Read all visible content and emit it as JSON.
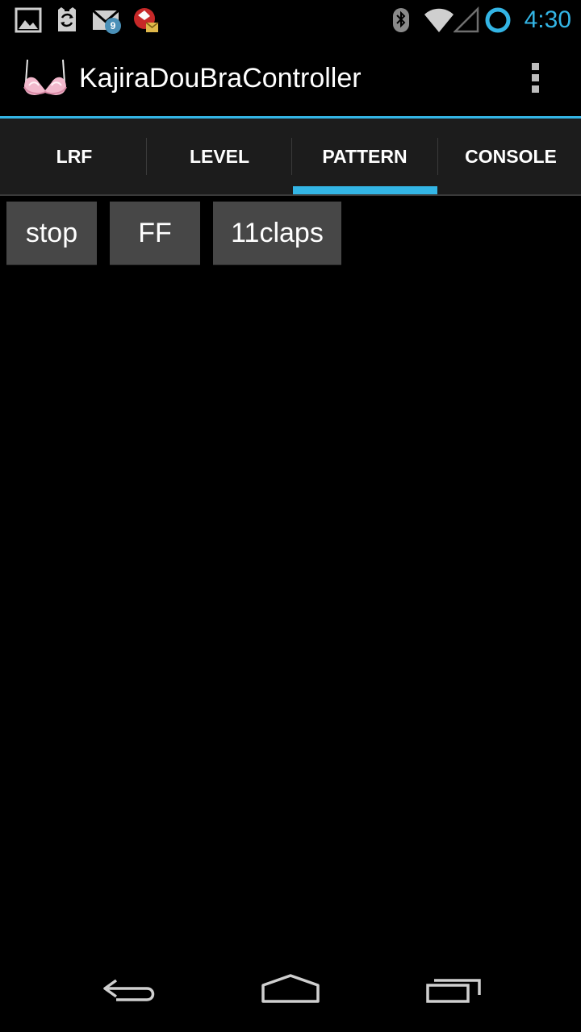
{
  "status_bar": {
    "time": "4:30",
    "notification_icons": [
      "gallery-icon",
      "sync-icon",
      "gmail-icon",
      "update-icon"
    ],
    "notification_badge": "9",
    "system_icons": [
      "bluetooth-icon",
      "wifi-icon",
      "cell-signal-icon",
      "sync-circle-icon"
    ],
    "accent_color": "#33b5e5"
  },
  "action_bar": {
    "title": "KajiraDouBraController",
    "app_icon": "bra-icon",
    "overflow_icon": "overflow-menu-icon"
  },
  "tabs": [
    {
      "label": "LRF",
      "selected": false
    },
    {
      "label": "LEVEL",
      "selected": false
    },
    {
      "label": "PATTERN",
      "selected": true
    },
    {
      "label": "CONSOLE",
      "selected": false
    }
  ],
  "pattern_buttons": [
    {
      "label": "stop"
    },
    {
      "label": "FF"
    },
    {
      "label": "11claps"
    }
  ],
  "nav_bar": {
    "icons": [
      "back-icon",
      "home-icon",
      "recent-apps-icon"
    ]
  },
  "colors": {
    "accent": "#33b5e5",
    "background": "#000000",
    "tab_bar": "#1c1c1c",
    "button": "#474747"
  }
}
